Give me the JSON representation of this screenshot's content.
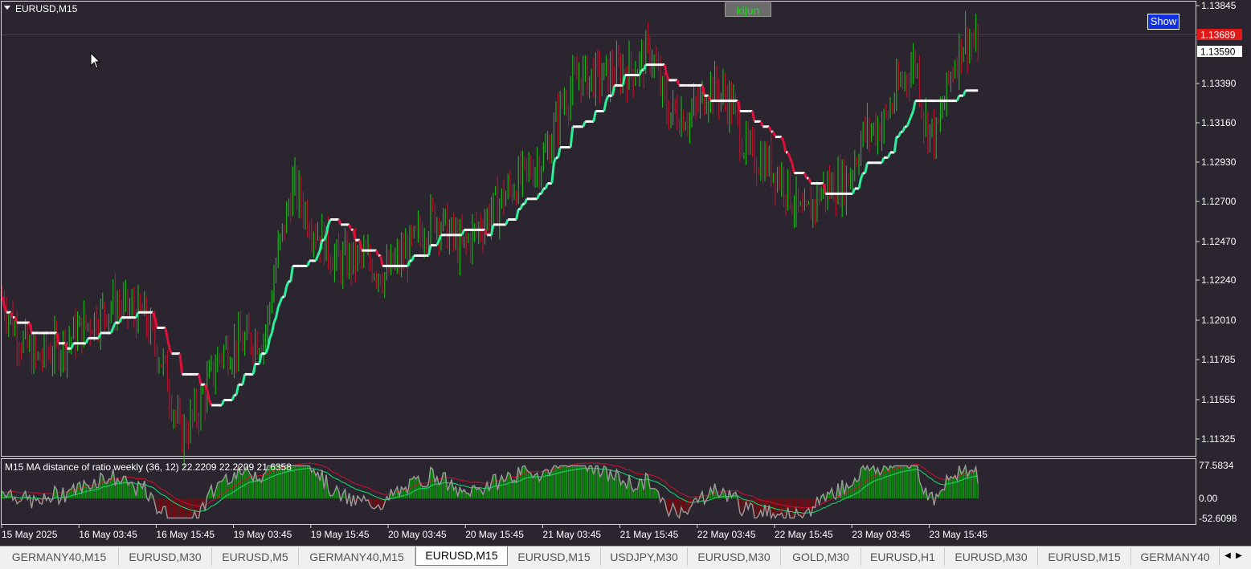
{
  "chart": {
    "symbol_title": "EURUSD,M15",
    "kijun_button": "kijun",
    "show_button": "Show",
    "current_price": "1.13689",
    "bid_price": "1.13590",
    "price_ticks": [
      "1.13845",
      "1.13390",
      "1.13160",
      "1.12930",
      "1.12700",
      "1.12470",
      "1.12240",
      "1.12010",
      "1.11785",
      "1.11555",
      "1.11325"
    ],
    "time_labels": [
      "15 May 2025",
      "16 May 03:45",
      "16 May 15:45",
      "19 May 03:45",
      "19 May 15:45",
      "20 May 03:45",
      "20 May 15:45",
      "21 May 03:45",
      "21 May 15:45",
      "22 May 03:45",
      "22 May 15:45",
      "23 May 03:45",
      "23 May 15:45"
    ]
  },
  "indicator": {
    "title": "M15 MA distance of ratio weekly (36,  12) 22.2209 22.2209 21.6358",
    "ticks": [
      "77.5834",
      "0.00",
      "-52.6098"
    ]
  },
  "tabs": [
    {
      "label": "GERMANY40,M15",
      "active": false
    },
    {
      "label": "EURUSD,M30",
      "active": false
    },
    {
      "label": "EURUSD,M5",
      "active": false
    },
    {
      "label": "GERMANY40,M15",
      "active": false
    },
    {
      "label": "EURUSD,M15",
      "active": true
    },
    {
      "label": "EURUSD,M15",
      "active": false
    },
    {
      "label": "USDJPY,M30",
      "active": false
    },
    {
      "label": "EURUSD,M30",
      "active": false
    },
    {
      "label": "GOLD,M30",
      "active": false
    },
    {
      "label": "EURUSD,H1",
      "active": false
    },
    {
      "label": "EURUSD,M30",
      "active": false
    },
    {
      "label": "EURUSD,M15",
      "active": false
    },
    {
      "label": "GERMANY40",
      "active": false
    }
  ],
  "colors": {
    "background": "#2b2530",
    "candle_up": "#16c816",
    "candle_down": "#c8102e",
    "kijun_up": "#2ef09a",
    "kijun_down": "#e0103a",
    "kijun_flat": "#ffffff",
    "hist_up": "#118a11",
    "hist_down": "#6e0e14",
    "price_line": "#c01010"
  },
  "chart_data": {
    "type": "candlestick",
    "symbol": "EURUSD",
    "timeframe": "M15",
    "price_range": [
      1.1125,
      1.1389
    ],
    "close_path_anchors": [
      [
        "15 May 2025",
        1.1216
      ],
      [
        "16 May 03:45",
        1.119
      ],
      [
        "16 May 15:45",
        1.1157
      ],
      [
        "19 May 03:45",
        1.1255
      ],
      [
        "19 May 15:45",
        1.1231
      ],
      [
        "20 May 03:45",
        1.1258
      ],
      [
        "20 May 15:45",
        1.127
      ],
      [
        "21 May 03:45",
        1.1345
      ],
      [
        "21 May 15:45",
        1.1339
      ],
      [
        "22 May 03:45",
        1.1318
      ],
      [
        "22 May 15:45",
        1.1268
      ],
      [
        "23 May 03:45",
        1.1352
      ],
      [
        "23 May 15:45",
        1.1359
      ]
    ],
    "indicator": {
      "name": "MA distance of ratio weekly (36, 12)",
      "values": [
        22.2209,
        22.2209,
        21.6358
      ],
      "range": [
        -52.6098,
        77.5834
      ]
    }
  }
}
